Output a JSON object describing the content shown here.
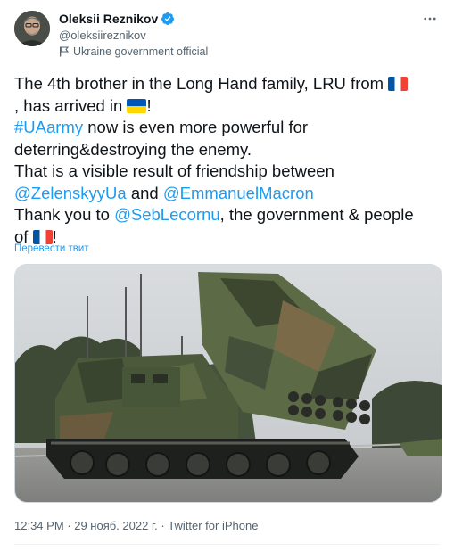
{
  "author": {
    "display_name": "Oleksii Reznikov",
    "handle": "@oleksiireznikov",
    "label": "Ukraine government official"
  },
  "tweet": {
    "line1_text": "The 4th brother in the Long Hand family, LRU from ",
    "line2_text": ", has arrived in ",
    "line2_end": "!",
    "hashtag": "#UAarmy",
    "line3_text": " now is even more powerful for",
    "line4_text": "deterring&destroying the enemy.",
    "line5_text": "That is a visible result of friendship between",
    "mention1": "@ZelenskyyUa",
    "and_text": " and ",
    "mention2": "@EmmanuelMacron",
    "line7_start": "Thank you to ",
    "mention3": "@SebLecornu",
    "line7_end": ", the government & people",
    "line8_start": "of ",
    "line8_end": "!"
  },
  "translate_label": "Перевести твит",
  "meta": {
    "time": "12:34 PM",
    "separator": " · ",
    "date": "29 нояб. 2022 г.",
    "source": "Twitter for iPhone"
  },
  "icons": {
    "verified": "verified-badge-icon",
    "government": "flag-label-icon",
    "more": "more-options-icon"
  },
  "colors": {
    "accent": "#1d9bf0",
    "secondary_text": "#536471",
    "primary_text": "#0f1419"
  }
}
